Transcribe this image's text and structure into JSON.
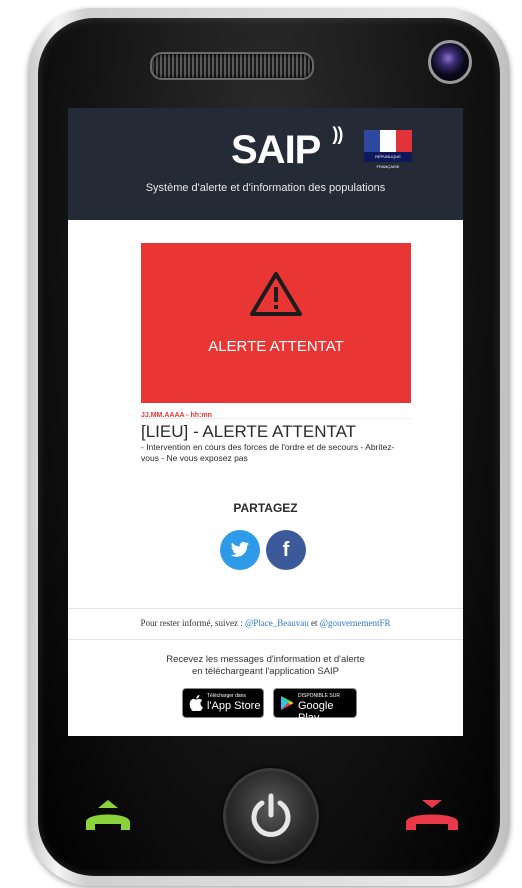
{
  "header": {
    "logo": "SAIP",
    "tagline": "Système d'alerte et d'information des populations",
    "flag_caption": "RÉPUBLIQUE FRANÇAISE"
  },
  "alert": {
    "banner_title": "ALERTE ATTENTAT",
    "date": "JJ.MM.AAAA - hh:mn",
    "title": "[LIEU] - ALERTE ATTENTAT",
    "description": "- Intervention en cours des forces de l'ordre et de secours  - Abritez-vous - Ne vous exposez pas"
  },
  "share": {
    "label": "PARTAGEZ",
    "twitter_icon": "twitter-icon",
    "facebook_icon": "facebook-icon"
  },
  "follow": {
    "prefix": "Pour rester informé, suivez :",
    "link1": "@Place_Beauvau",
    "joiner": "et",
    "link2": "@gouvernementFR"
  },
  "app": {
    "line1": "Recevez les messages d'information et d'alerte",
    "line2": "en téléchargeant l'application SAIP",
    "appstore_small": "Télécharger dans",
    "appstore_big": "l'App Store",
    "gplay_small": "DISPONIBLE SUR",
    "gplay_big": "Google Play"
  },
  "colors": {
    "header_bg": "#242a36",
    "alert_red": "#e93634",
    "twitter_blue": "#2f9be8",
    "facebook_blue": "#3c5a9a",
    "call_green": "#8bd33a",
    "end_red": "#e8384a"
  }
}
